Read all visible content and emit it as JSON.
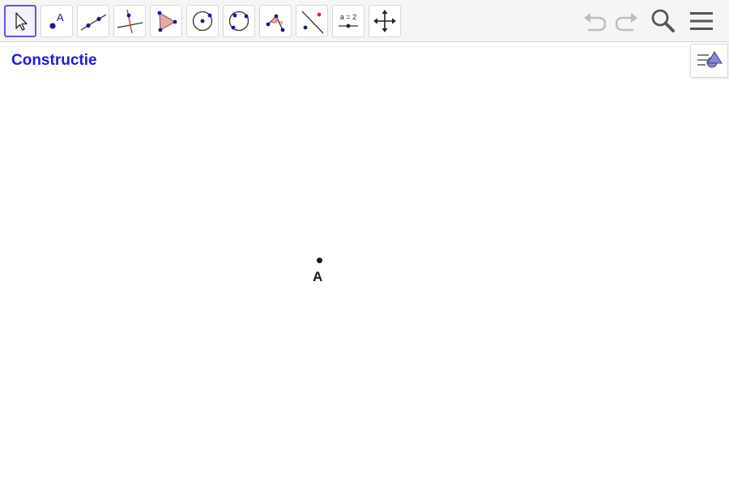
{
  "toolbar": {
    "tools": [
      {
        "name": "move",
        "icon": "arrow-pointer-icon",
        "selected": true
      },
      {
        "name": "point",
        "icon": "point-icon",
        "label": "A"
      },
      {
        "name": "line",
        "icon": "line-through-two-points-icon"
      },
      {
        "name": "perpendicular-line",
        "icon": "perpendicular-line-icon"
      },
      {
        "name": "polygon",
        "icon": "polygon-icon"
      },
      {
        "name": "circle",
        "icon": "circle-center-point-icon"
      },
      {
        "name": "circle-three-points",
        "icon": "circle-three-points-icon"
      },
      {
        "name": "angle",
        "icon": "angle-icon",
        "label": "α"
      },
      {
        "name": "reflect",
        "icon": "reflect-about-line-icon"
      },
      {
        "name": "slider",
        "icon": "slider-icon",
        "label": "a = 2"
      },
      {
        "name": "move-graphics-view",
        "icon": "move-graphics-view-icon"
      }
    ],
    "right": [
      "undo-icon",
      "redo-icon",
      "search-icon",
      "menu-icon"
    ]
  },
  "canvas": {
    "title": "Constructie",
    "points": [
      {
        "label": "A"
      }
    ]
  },
  "colors": {
    "accent": "#6557d2",
    "title": "#1c1ce0",
    "point_blue": "#1a1a8c",
    "shape_fill": "#e8a8a8"
  }
}
